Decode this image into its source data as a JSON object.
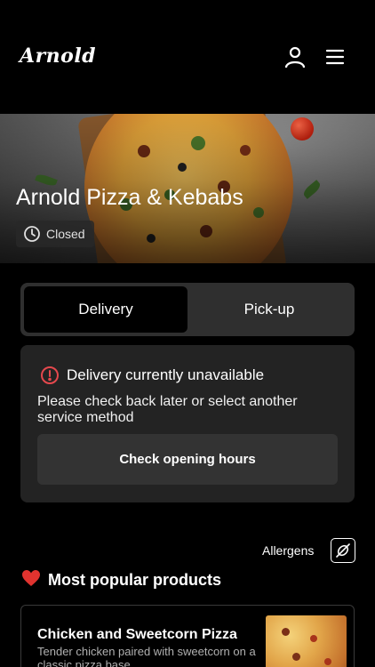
{
  "header": {
    "logo": "Arnold",
    "account_icon": "user-icon",
    "menu_icon": "hamburger-menu-icon"
  },
  "hero": {
    "title": "Arnold Pizza & Kebabs",
    "status_icon": "clock-icon",
    "status": "Closed"
  },
  "service_toggle": {
    "options": [
      "Delivery",
      "Pick-up"
    ],
    "selected": "Delivery"
  },
  "notice": {
    "icon": "alert-circle-icon",
    "title": "Delivery currently unavailable",
    "description": "Please check back later or select another service method",
    "button_label": "Check opening hours"
  },
  "allergens": {
    "label": "Allergens",
    "icon": "allergens-icon"
  },
  "popular": {
    "emoji": "❤️",
    "title": "Most popular products",
    "products": [
      {
        "name": "Chicken and Sweetcorn Pizza",
        "description": "Tender chicken paired with sweetcorn on a classic pizza base"
      }
    ]
  },
  "colors": {
    "background": "#000000",
    "card": "#232323",
    "toggle_track": "#2f2f2f",
    "alert_red": "#e5484d"
  }
}
